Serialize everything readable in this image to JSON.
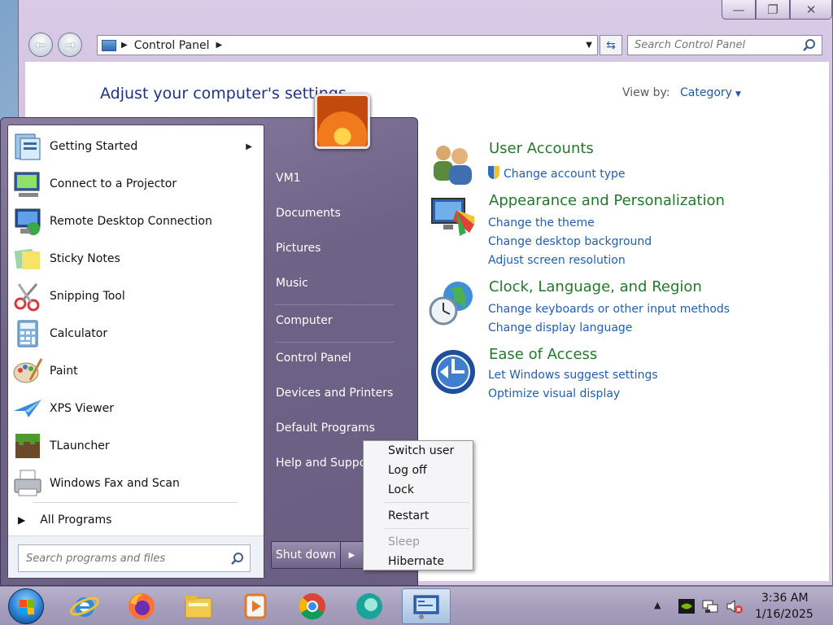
{
  "window": {
    "address_path": "Control Panel",
    "search_placeholder": "Search Control Panel",
    "heading": "Adjust your computer's settings",
    "view_by_label": "View by:",
    "view_by_value": "Category",
    "categories": [
      {
        "title": "User Accounts",
        "links": [
          "Change account type"
        ],
        "icon": "user-accounts-icon"
      },
      {
        "title": "Appearance and Personalization",
        "links": [
          "Change the theme",
          "Change desktop background",
          "Adjust screen resolution"
        ],
        "icon": "appearance-icon"
      },
      {
        "title": "Clock, Language, and Region",
        "links": [
          "Change keyboards or other input methods",
          "Change display language"
        ],
        "icon": "clock-globe-icon"
      },
      {
        "title": "Ease of Access",
        "links": [
          "Let Windows suggest settings",
          "Optimize visual display"
        ],
        "icon": "ease-of-access-icon"
      }
    ]
  },
  "start_menu": {
    "programs": [
      {
        "label": "Getting Started",
        "icon": "getting-started-icon"
      },
      {
        "label": "Connect to a Projector",
        "icon": "projector-icon"
      },
      {
        "label": "Remote Desktop Connection",
        "icon": "remote-desktop-icon"
      },
      {
        "label": "Sticky Notes",
        "icon": "sticky-notes-icon"
      },
      {
        "label": "Snipping Tool",
        "icon": "snipping-tool-icon"
      },
      {
        "label": "Calculator",
        "icon": "calculator-icon"
      },
      {
        "label": "Paint",
        "icon": "paint-icon"
      },
      {
        "label": "XPS Viewer",
        "icon": "xps-viewer-icon"
      },
      {
        "label": "TLauncher",
        "icon": "tlauncher-icon"
      },
      {
        "label": "Windows Fax and Scan",
        "icon": "fax-scan-icon"
      }
    ],
    "all_programs": "All Programs",
    "search_placeholder": "Search programs and files",
    "right_items": [
      "VM1",
      "Documents",
      "Pictures",
      "Music",
      "Computer",
      "Control Panel",
      "Devices and Printers",
      "Default Programs",
      "Help and Suppo"
    ],
    "shutdown_label": "Shut down"
  },
  "shutdown_menu": {
    "items": [
      "Switch user",
      "Log off",
      "Lock",
      "Restart",
      "Sleep",
      "Hibernate"
    ]
  },
  "taskbar": {
    "time": "3:36 AM",
    "date": "1/16/2025",
    "apps": [
      "internet-explorer-icon",
      "firefox-icon",
      "file-explorer-icon",
      "media-player-icon",
      "chrome-icon",
      "bing-app-icon",
      "control-panel-icon"
    ]
  }
}
